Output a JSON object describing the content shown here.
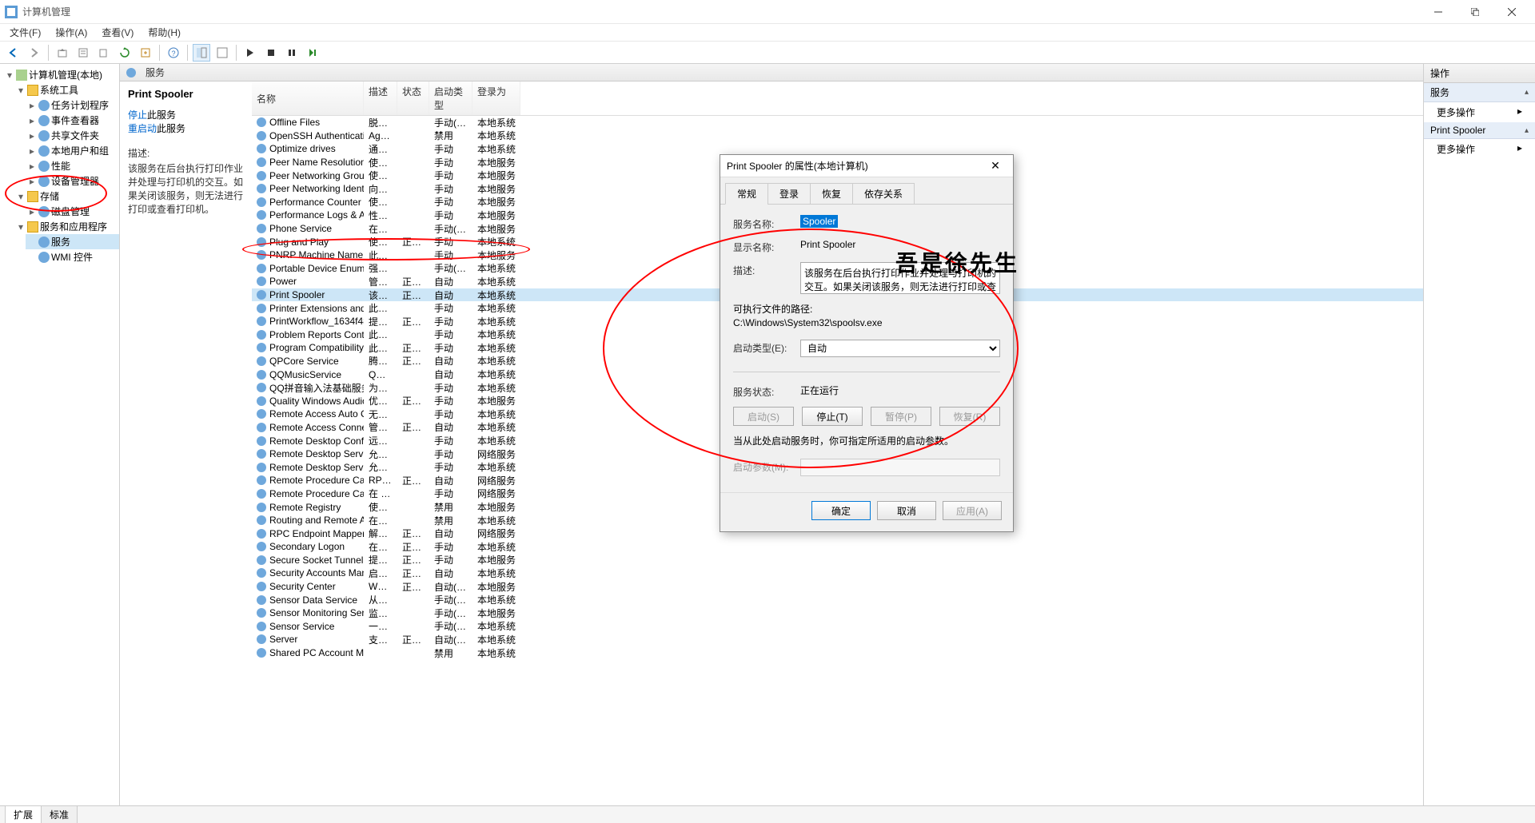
{
  "window": {
    "title": "计算机管理"
  },
  "menubar": [
    "文件(F)",
    "操作(A)",
    "查看(V)",
    "帮助(H)"
  ],
  "header": {
    "label": "服务"
  },
  "tree": {
    "root": "计算机管理(本地)",
    "systools": "系统工具",
    "systools_items": [
      "任务计划程序",
      "事件查看器",
      "共享文件夹",
      "本地用户和组",
      "性能",
      "设备管理器"
    ],
    "storage": "存储",
    "storage_items": [
      "磁盘管理"
    ],
    "svcapps": "服务和应用程序",
    "svcapps_items": [
      "服务",
      "WMI 控件"
    ]
  },
  "detail": {
    "title": "Print Spooler",
    "stop_prefix": "停止",
    "stop_suffix": "此服务",
    "restart_prefix": "重启动",
    "restart_suffix": "此服务",
    "desc_label": "描述:",
    "desc_text": "该服务在后台执行打印作业并处理与打印机的交互。如果关闭该服务，则无法进行打印或查看打印机。"
  },
  "columns": {
    "name": "名称",
    "desc": "描述",
    "status": "状态",
    "start": "启动类型",
    "logon": "登录为"
  },
  "services": [
    {
      "n": "Offline Files",
      "d": "脱机…",
      "s": "",
      "t": "手动(触发…",
      "l": "本地系统"
    },
    {
      "n": "OpenSSH Authentication …",
      "d": "Age…",
      "s": "",
      "t": "禁用",
      "l": "本地系统"
    },
    {
      "n": "Optimize drives",
      "d": "通过…",
      "s": "",
      "t": "手动",
      "l": "本地系统"
    },
    {
      "n": "Peer Name Resolution Pr…",
      "d": "使用…",
      "s": "",
      "t": "手动",
      "l": "本地服务"
    },
    {
      "n": "Peer Networking Groupi…",
      "d": "使用…",
      "s": "",
      "t": "手动",
      "l": "本地服务"
    },
    {
      "n": "Peer Networking Identity…",
      "d": "向对…",
      "s": "",
      "t": "手动",
      "l": "本地服务"
    },
    {
      "n": "Performance Counter DL…",
      "d": "使远…",
      "s": "",
      "t": "手动",
      "l": "本地服务"
    },
    {
      "n": "Performance Logs & Aler…",
      "d": "性能…",
      "s": "",
      "t": "手动",
      "l": "本地服务"
    },
    {
      "n": "Phone Service",
      "d": "在设…",
      "s": "",
      "t": "手动(触发…",
      "l": "本地服务"
    },
    {
      "n": "Plug and Play",
      "d": "使计…",
      "s": "正在…",
      "t": "手动",
      "l": "本地系统"
    },
    {
      "n": "PNRP Machine Name Pu…",
      "d": "此服…",
      "s": "",
      "t": "手动",
      "l": "本地服务"
    },
    {
      "n": "Portable Device Enumera…",
      "d": "强制…",
      "s": "",
      "t": "手动(触发…",
      "l": "本地系统"
    },
    {
      "n": "Power",
      "d": "管理…",
      "s": "正在…",
      "t": "自动",
      "l": "本地系统"
    },
    {
      "n": "Print Spooler",
      "d": "该服…",
      "s": "正在…",
      "t": "自动",
      "l": "本地系统",
      "sel": true
    },
    {
      "n": "Printer Extensions and N…",
      "d": "此服…",
      "s": "",
      "t": "手动",
      "l": "本地系统"
    },
    {
      "n": "PrintWorkflow_1634f480",
      "d": "提供…",
      "s": "正在…",
      "t": "手动",
      "l": "本地系统"
    },
    {
      "n": "Problem Reports Control…",
      "d": "此服…",
      "s": "",
      "t": "手动",
      "l": "本地系统"
    },
    {
      "n": "Program Compatibility A…",
      "d": "此服…",
      "s": "正在…",
      "t": "手动",
      "l": "本地系统"
    },
    {
      "n": "QPCore Service",
      "d": "腾讯…",
      "s": "正在…",
      "t": "自动",
      "l": "本地系统"
    },
    {
      "n": "QQMusicService",
      "d": "QQ…",
      "s": "",
      "t": "自动",
      "l": "本地系统"
    },
    {
      "n": "QQ拼音输入法基础服务",
      "d": "为Q…",
      "s": "",
      "t": "手动",
      "l": "本地系统"
    },
    {
      "n": "Quality Windows Audio V…",
      "d": "优质…",
      "s": "正在…",
      "t": "手动",
      "l": "本地服务"
    },
    {
      "n": "Remote Access Auto Con…",
      "d": "无论…",
      "s": "",
      "t": "手动",
      "l": "本地系统"
    },
    {
      "n": "Remote Access Connecti…",
      "d": "管理…",
      "s": "正在…",
      "t": "自动",
      "l": "本地系统"
    },
    {
      "n": "Remote Desktop Configu…",
      "d": "远程…",
      "s": "",
      "t": "手动",
      "l": "本地系统"
    },
    {
      "n": "Remote Desktop Services",
      "d": "允许…",
      "s": "",
      "t": "手动",
      "l": "网络服务"
    },
    {
      "n": "Remote Desktop Service…",
      "d": "允许…",
      "s": "",
      "t": "手动",
      "l": "本地系统"
    },
    {
      "n": "Remote Procedure Call (…",
      "d": "RPC…",
      "s": "正在…",
      "t": "自动",
      "l": "网络服务"
    },
    {
      "n": "Remote Procedure Call (…",
      "d": "在 W…",
      "s": "",
      "t": "手动",
      "l": "网络服务"
    },
    {
      "n": "Remote Registry",
      "d": "使远…",
      "s": "",
      "t": "禁用",
      "l": "本地服务"
    },
    {
      "n": "Routing and Remote Acc…",
      "d": "在局…",
      "s": "",
      "t": "禁用",
      "l": "本地系统"
    },
    {
      "n": "RPC Endpoint Mapper",
      "d": "解析…",
      "s": "正在…",
      "t": "自动",
      "l": "网络服务"
    },
    {
      "n": "Secondary Logon",
      "d": "在不…",
      "s": "正在…",
      "t": "手动",
      "l": "本地系统"
    },
    {
      "n": "Secure Socket Tunneling …",
      "d": "提供…",
      "s": "正在…",
      "t": "手动",
      "l": "本地服务"
    },
    {
      "n": "Security Accounts Manag…",
      "d": "启动…",
      "s": "正在…",
      "t": "自动",
      "l": "本地系统"
    },
    {
      "n": "Security Center",
      "d": "WSC…",
      "s": "正在…",
      "t": "自动(延迟…",
      "l": "本地服务"
    },
    {
      "n": "Sensor Data Service",
      "d": "从各…",
      "s": "",
      "t": "手动(触发…",
      "l": "本地系统"
    },
    {
      "n": "Sensor Monitoring Service",
      "d": "监视…",
      "s": "",
      "t": "手动(触发…",
      "l": "本地服务"
    },
    {
      "n": "Sensor Service",
      "d": "一项…",
      "s": "",
      "t": "手动(触发…",
      "l": "本地系统"
    },
    {
      "n": "Server",
      "d": "支持…",
      "s": "正在…",
      "t": "自动(触发…",
      "l": "本地系统"
    },
    {
      "n": "Shared PC Account Mana…",
      "d": "",
      "s": "",
      "t": "禁用",
      "l": "本地系统"
    }
  ],
  "bottom_tabs": [
    "扩展",
    "标准"
  ],
  "actions": {
    "title": "操作",
    "sec1": "服务",
    "item1": "更多操作",
    "sec2": "Print Spooler",
    "item2": "更多操作"
  },
  "dialog": {
    "title": "Print Spooler 的属性(本地计算机)",
    "tabs": [
      "常规",
      "登录",
      "恢复",
      "依存关系"
    ],
    "svc_name_label": "服务名称:",
    "svc_name_value": "Spooler",
    "disp_name_label": "显示名称:",
    "disp_name_value": "Print Spooler",
    "desc_label": "描述:",
    "desc_value": "该服务在后台执行打印作业并处理与打印机的交互。如果关闭该服务，则无法进行打印或查看打印机。",
    "exe_label": "可执行文件的路径:",
    "exe_value": "C:\\Windows\\System32\\spoolsv.exe",
    "start_type_label": "启动类型(E):",
    "start_type_value": "自动",
    "status_label": "服务状态:",
    "status_value": "正在运行",
    "btn_start": "启动(S)",
    "btn_stop": "停止(T)",
    "btn_pause": "暂停(P)",
    "btn_resume": "恢复(R)",
    "hint": "当从此处启动服务时，你可指定所适用的启动参数。",
    "param_label": "启动参数(M):",
    "ok": "确定",
    "cancel": "取消",
    "apply": "应用(A)"
  },
  "annotation_text": "吾是徐先生"
}
